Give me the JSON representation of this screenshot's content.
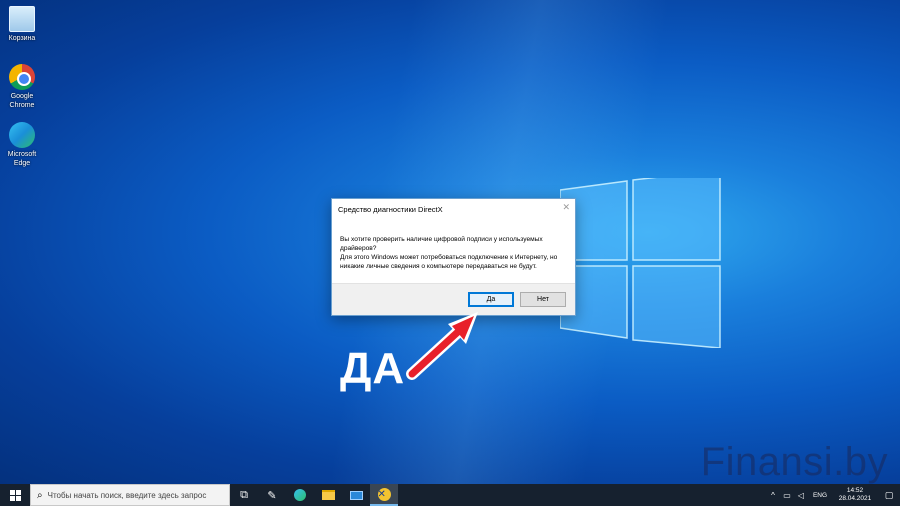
{
  "desktop": {
    "icons": [
      {
        "name": "recycle-bin-icon",
        "label": "Корзина"
      },
      {
        "name": "chrome-icon",
        "label": "Google Chrome"
      },
      {
        "name": "edge-icon",
        "label": "Microsoft Edge"
      }
    ]
  },
  "dialog": {
    "title": "Средство диагностики DirectX",
    "line1": "Вы хотите проверить наличие цифровой подписи у используемых драйверов?",
    "line2": "Для этого Windows может потребоваться подключение к Интернету, но никакие личные сведения о компьютере передаваться не будут.",
    "yes_label": "Да",
    "no_label": "Нет",
    "close_glyph": "✕"
  },
  "annotation": {
    "text": "ДА",
    "arrow_color": "#e8202a"
  },
  "watermark": "Finansi.by",
  "taskbar": {
    "search_placeholder": "Чтобы начать поиск, введите здесь запрос",
    "language": "ENG",
    "time": "14:52",
    "date": "28.04.2021"
  },
  "colors": {
    "accent": "#0078d7",
    "taskbar": "#16212f"
  }
}
